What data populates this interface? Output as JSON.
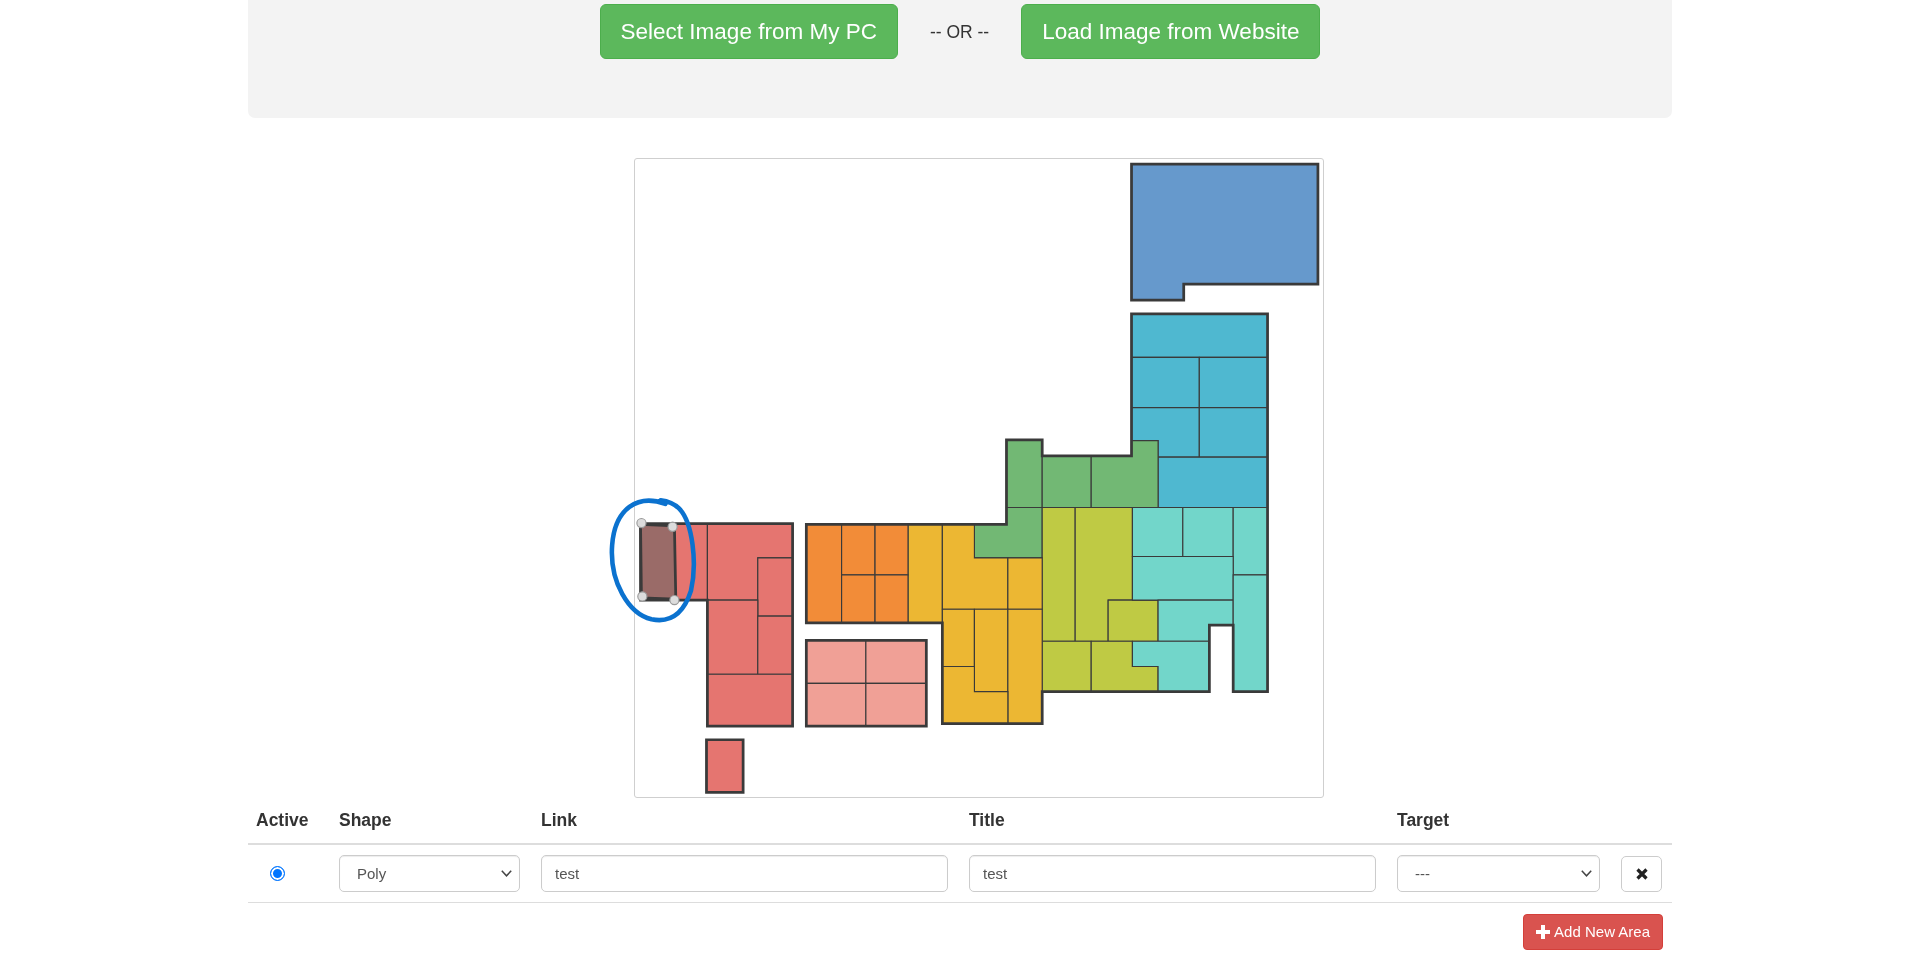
{
  "image_source": {
    "buttons": [
      "Select Image from My PC",
      "Load Image from Website"
    ],
    "separator": "-- OR --"
  },
  "areas_table": {
    "columns": [
      "Active",
      "Shape",
      "Link",
      "Title",
      "Target"
    ],
    "rows": [
      {
        "active": true,
        "shape": "Poly",
        "link": "test",
        "title": "test",
        "target": "---"
      }
    ]
  },
  "add_button": {
    "label": "Add New Area"
  }
}
